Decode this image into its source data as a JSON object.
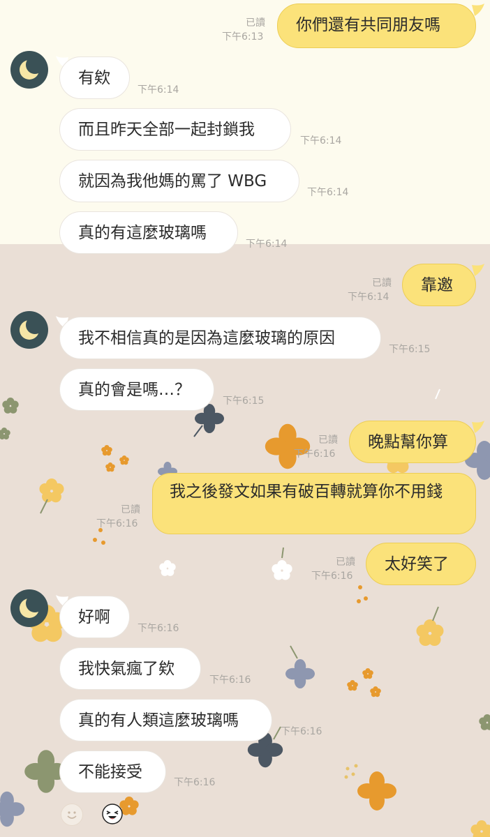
{
  "chat": {
    "messages": [
      {
        "id": "m1",
        "side": "out",
        "text": "你們還有共同朋友嗎",
        "read": "已讀",
        "time": "下午6:13"
      },
      {
        "id": "m2",
        "side": "in",
        "text": "有欸",
        "time": "下午6:14"
      },
      {
        "id": "m3",
        "side": "in",
        "text": "而且昨天全部一起封鎖我",
        "time": "下午6:14"
      },
      {
        "id": "m4",
        "side": "in",
        "text": "就因為我他媽的罵了 WBG",
        "time": "下午6:14"
      },
      {
        "id": "m5",
        "side": "in",
        "text": "真的有這麼玻璃嗎",
        "time": "下午6:14"
      },
      {
        "id": "m6",
        "side": "out",
        "text": "靠邀",
        "read": "已讀",
        "time": "下午6:14"
      },
      {
        "id": "m7",
        "side": "in",
        "text": "我不相信真的是因為這麼玻璃的原因",
        "time": "下午6:15"
      },
      {
        "id": "m8",
        "side": "in",
        "text": "真的會是嗎…？",
        "time": "下午6:15"
      },
      {
        "id": "m9",
        "side": "out",
        "text": "晚點幫你算",
        "read": "已讀",
        "time": "下午6:16"
      },
      {
        "id": "m10",
        "side": "out",
        "text": "我之後發文如果有破百轉就算你不用錢",
        "read": "已讀",
        "time": "下午6:16"
      },
      {
        "id": "m11",
        "side": "out",
        "text": "太好笑了",
        "read": "已讀",
        "time": "下午6:16"
      },
      {
        "id": "m12",
        "side": "in",
        "text": "好啊",
        "time": "下午6:16"
      },
      {
        "id": "m13",
        "side": "in",
        "text": "我快氣瘋了欸",
        "time": "下午6:16"
      },
      {
        "id": "m14",
        "side": "in",
        "text": "真的有人類這麼玻璃嗎",
        "time": "下午6:16"
      },
      {
        "id": "m15",
        "side": "in",
        "text": "不能接受",
        "time": "下午6:16"
      }
    ]
  },
  "contact": {
    "avatar_icon": "crescent-moon-icon"
  },
  "reactions": [
    {
      "icon": "smiley-icon"
    },
    {
      "icon": "laughing-face-sticker-icon"
    }
  ],
  "colors": {
    "out_bubble": "#fbe27a",
    "in_bubble": "#ffffff",
    "background_top": "#fdfbee",
    "background_bottom": "#eadfd6",
    "avatar": "#3a5156",
    "moon": "#f6e6a6"
  }
}
